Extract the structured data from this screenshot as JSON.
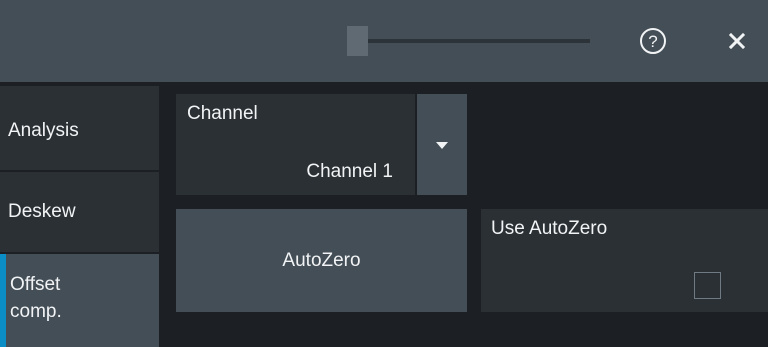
{
  "titlebar": {
    "help_icon": "help-circle-icon",
    "close_icon": "close-icon"
  },
  "sidebar": {
    "tabs": [
      {
        "label": "Analysis",
        "active": false
      },
      {
        "label": "Deskew",
        "active": false
      },
      {
        "label": "Offset\ncomp.",
        "label_line1": "Offset",
        "label_line2": "comp.",
        "active": true
      }
    ]
  },
  "main": {
    "channel": {
      "label": "Channel",
      "value": "Channel 1"
    },
    "autozero_button_label": "AutoZero",
    "use_autozero": {
      "label": "Use AutoZero",
      "checked": false
    }
  },
  "colors": {
    "accent": "#0b8ec5",
    "panel": "#2b3035",
    "button": "#434e57",
    "background": "#1c1f23",
    "text": "#f1f3f4"
  }
}
